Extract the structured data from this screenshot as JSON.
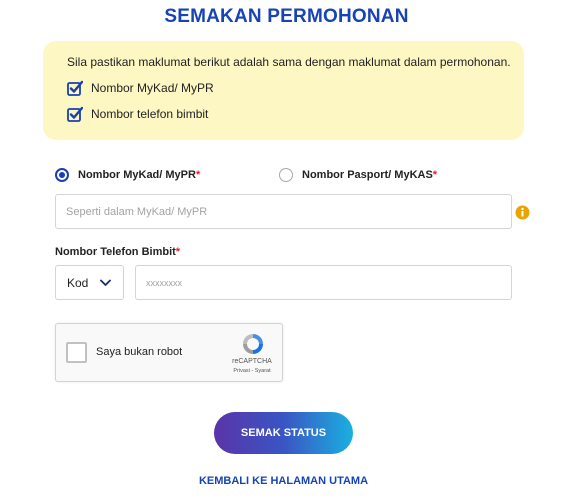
{
  "title": "SEMAKAN PERMOHONAN",
  "notice": {
    "intro": "Sila pastikan maklumat berikut adalah sama dengan maklumat dalam permohonan.",
    "items": [
      "Nombor MyKad/ MyPR",
      "Nombor telefon bimbit"
    ]
  },
  "id_type": {
    "option_mykad": "Nombor MyKad/ MyPR",
    "option_passport": "Nombor Pasport/ MyKAS",
    "required_mark": "*",
    "selected": "Nombor MyKad/ MyPR"
  },
  "id_input": {
    "placeholder": "Seperti dalam MyKad/ MyPR",
    "value": ""
  },
  "phone": {
    "label": "Nombor Telefon Bimbit",
    "required_mark": "*",
    "code_select": "Kod",
    "placeholder": "xxxxxxxx",
    "value": ""
  },
  "captcha": {
    "label": "Saya bukan robot",
    "brand": "reCAPTCHA",
    "links": "Privasi - Syarat"
  },
  "submit_label": "SEMAK STATUS",
  "back_link": "KEMBALI KE HALAMAN UTAMA",
  "colors": {
    "accent": "#1743b5",
    "notice_bg": "#fdf7c3",
    "required": "#e0202e",
    "info": "#e8a400"
  }
}
